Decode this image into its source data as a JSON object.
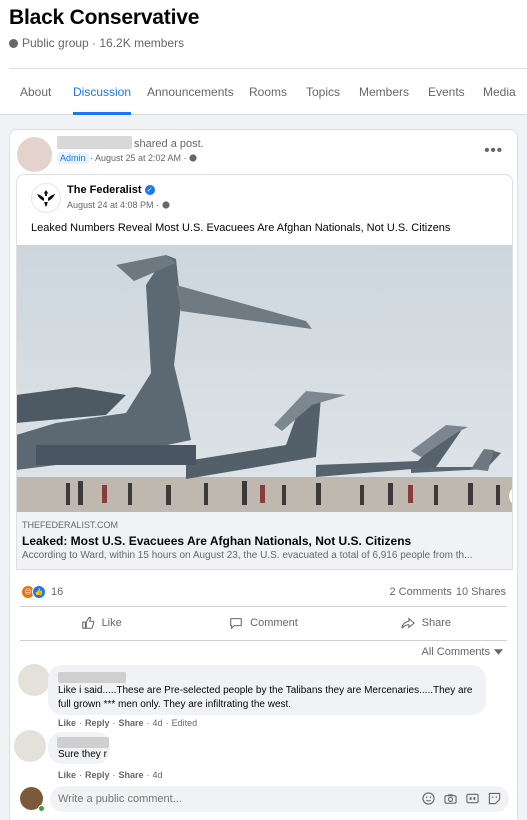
{
  "group": {
    "title": "Black Conservative",
    "meta": "Public group · 16.2K members"
  },
  "tabs": [
    "About",
    "Discussion",
    "Announcements",
    "Rooms",
    "Topics",
    "Members",
    "Events",
    "Media"
  ],
  "active_tab": "Discussion",
  "post": {
    "shared_text": "shared a post.",
    "admin_badge": "Admin",
    "time": "· August 25 at 2:02 AM ·",
    "shared": {
      "publisher": "The Federalist",
      "time": "August 24 at 4:08 PM ·",
      "text": "Leaked Numbers Reveal Most U.S. Evacuees Are Afghan Nationals, Not U.S. Citizens",
      "link_domain": "THEFEDERALIST.COM",
      "link_title": "Leaked: Most U.S. Evacuees Are Afghan Nationals, Not U.S. Citizens",
      "link_desc": "According to Ward, within 15 hours on August 23, the U.S. evacuated a total of 6,916 people from th..."
    },
    "reaction_count": "16",
    "comments_count": "2 Comments",
    "shares_count": "10 Shares",
    "actions": {
      "like": "Like",
      "comment": "Comment",
      "share": "Share"
    }
  },
  "comments_sort": "All Comments",
  "comments": [
    {
      "text": "Like i said.....These are Pre-selected people by the Talibans they are Mercenaries.....They are full grown *** men only. They are infiltrating the west.",
      "like": "Like",
      "reply": "Reply",
      "share": "Share",
      "age": "4d",
      "edited": "Edited"
    },
    {
      "text": "Sure they r",
      "like": "Like",
      "reply": "Reply",
      "share": "Share",
      "age": "4d"
    }
  ],
  "compose": {
    "placeholder": "Write a public comment..."
  }
}
